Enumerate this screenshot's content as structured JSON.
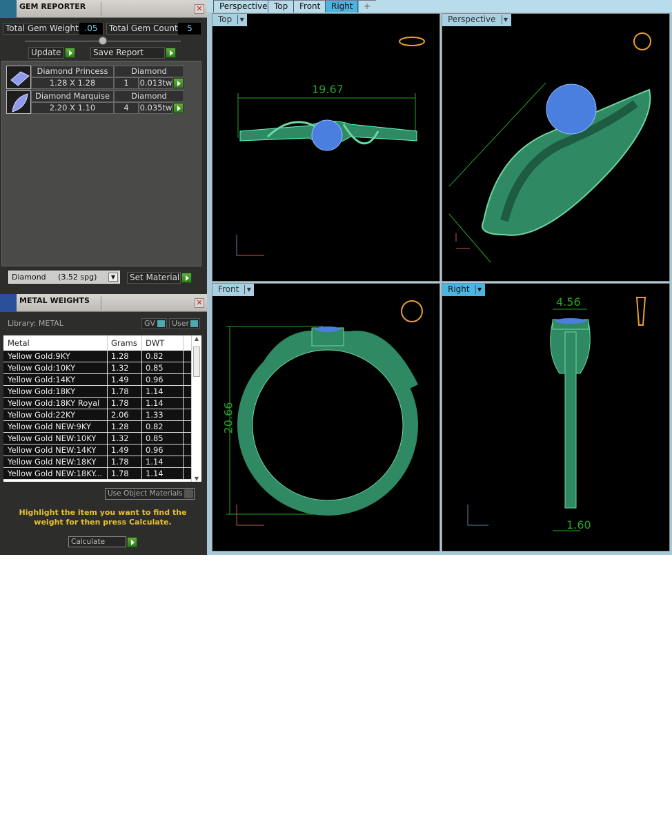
{
  "gem_reporter": {
    "title": "GEM REPORTER",
    "total_weight_label": "Total Gem Weight",
    "total_weight": ".05",
    "total_count_label": "Total Gem Count",
    "total_count": "5",
    "update": "Update",
    "save_report": "Save Report",
    "gems": [
      {
        "name": "Diamond Princess",
        "material": "Diamond",
        "size": "1.28 X 1.28",
        "count": "1",
        "weight": "0.013tw"
      },
      {
        "name": "Diamond Marquise",
        "material": "Diamond",
        "size": "2.20 X 1.10",
        "count": "4",
        "weight": "0.035tw"
      }
    ],
    "material_select": "Diamond     (3.52 spg)",
    "set_material": "Set Material"
  },
  "metal_weights": {
    "title": "METAL WEIGHTS",
    "library": "Library: METAL",
    "gv": "GV",
    "user": "User",
    "columns": [
      "Metal",
      "Grams",
      "DWT"
    ],
    "rows": [
      [
        "Yellow Gold:9KY",
        "1.28",
        "0.82"
      ],
      [
        "Yellow Gold:10KY",
        "1.32",
        "0.85"
      ],
      [
        "Yellow Gold:14KY",
        "1.49",
        "0.96"
      ],
      [
        "Yellow Gold:18KY",
        "1.78",
        "1.14"
      ],
      [
        "Yellow Gold:18KY Royal",
        "1.78",
        "1.14"
      ],
      [
        "Yellow Gold:22KY",
        "2.06",
        "1.33"
      ],
      [
        "Yellow Gold NEW:9KY",
        "1.28",
        "0.82"
      ],
      [
        "Yellow Gold NEW:10KY",
        "1.32",
        "0.85"
      ],
      [
        "Yellow Gold NEW:14KY",
        "1.49",
        "0.96"
      ],
      [
        "Yellow Gold NEW:18KY",
        "1.78",
        "1.14"
      ],
      [
        "Yellow Gold NEW:18KY...",
        "1.78",
        "1.14"
      ]
    ],
    "use_object_materials": "Use Object Materials",
    "hint": "Highlight the item you want to find the weight for then press Calculate.",
    "calculate": "Calculate"
  },
  "viewport_tabs": [
    "Perspective",
    "Top",
    "Front",
    "Right",
    "+"
  ],
  "active_tab": "Right",
  "viewports": {
    "top": {
      "label": "Top",
      "dim": "19.67"
    },
    "perspective": {
      "label": "Perspective"
    },
    "front": {
      "label": "Front",
      "dim": "20.66"
    },
    "right": {
      "label": "Right",
      "dim1": "4.56",
      "dim2": "1.60"
    }
  },
  "colors": {
    "metal": "#2f8a63",
    "gem": "#4a7fe0",
    "dimension": "#2aa02a",
    "active_tab": "#4ab6e0"
  }
}
